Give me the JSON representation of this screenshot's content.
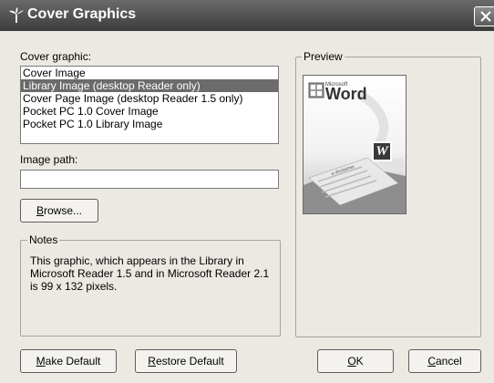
{
  "window": {
    "title": "Cover Graphics"
  },
  "cover_graphic": {
    "label": "Cover graphic:",
    "items": [
      {
        "label": "Cover Image",
        "selected": false
      },
      {
        "label": "Library Image (desktop Reader only)",
        "selected": true
      },
      {
        "label": "Cover Page Image (desktop Reader 1.5 only)",
        "selected": false
      },
      {
        "label": "Pocket PC 1.0 Cover Image",
        "selected": false
      },
      {
        "label": "Pocket PC 1.0 Library Image",
        "selected": false
      }
    ]
  },
  "image_path": {
    "label": "Image path:",
    "value": ""
  },
  "browse_button": {
    "label_mnemonic": "B",
    "label_rest": "rowse..."
  },
  "notes": {
    "legend": "Notes",
    "text": "This graphic, which appears in the Library in Microsoft Reader 1.5  and in Microsoft Reader 2.1 is 99 x 132 pixels."
  },
  "preview": {
    "legend": "Preview",
    "brand_small": "Microsoft",
    "brand_large": "Word",
    "badge": "W",
    "doc_heading": "a disclaimer"
  },
  "buttons": {
    "make_default": {
      "mnemonic": "M",
      "rest": "ake Default"
    },
    "restore_default": {
      "mnemonic": "R",
      "rest": "estore Default"
    },
    "ok": {
      "mnemonic": "O",
      "rest": "K"
    },
    "cancel": {
      "mnemonic": "C",
      "rest": "ancel"
    }
  },
  "colors": {
    "title_bar": "#4a4a4a",
    "dialog_bg": "#ece9e3",
    "selection": "#6b6b6b"
  }
}
